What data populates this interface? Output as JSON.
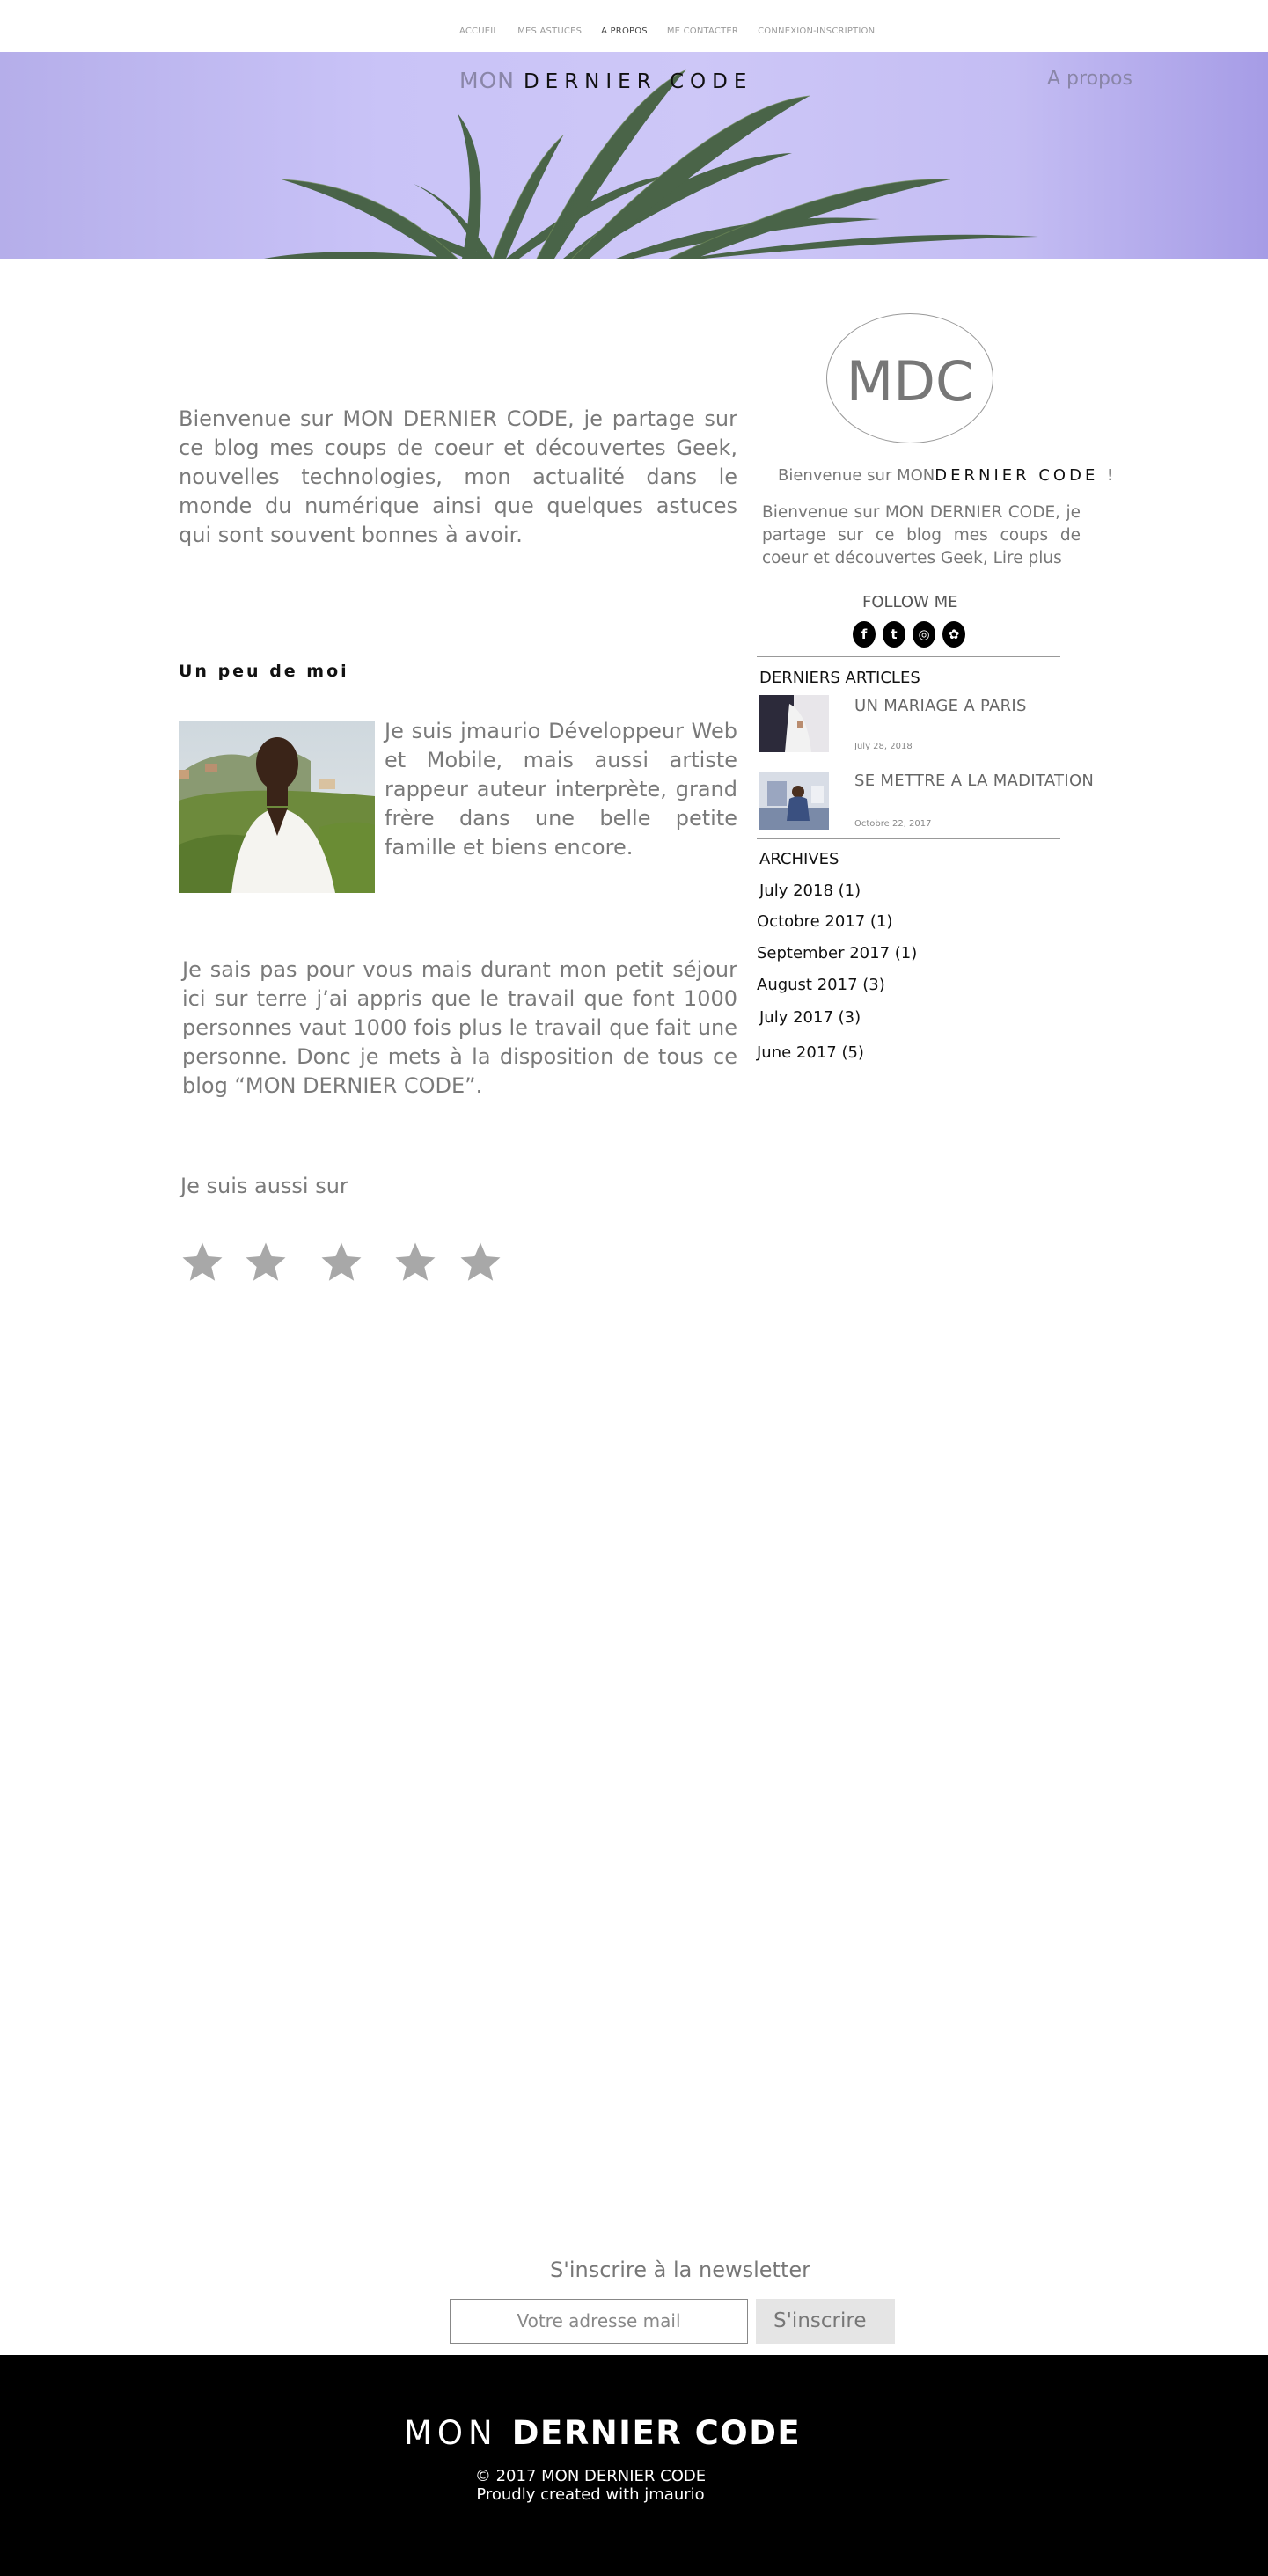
{
  "nav": {
    "items": [
      "ACCUEIL",
      "MES ASTUCES",
      "A PROPOS",
      "ME CONTACTER",
      "CONNEXION-INSCRIPTION"
    ],
    "active": "A PROPOS"
  },
  "header": {
    "brand_light": "MON",
    "brand_strong": "DERNIER CODE",
    "page_link": "A propos"
  },
  "main": {
    "intro": "Bienvenue sur MON DERNIER CODE, je partage sur ce blog mes coups de coeur et découvertes Geek, nouvelles technologies, mon actualité dans le monde du numérique ainsi que quelques  astuces qui sont souvent bonnes à avoir.",
    "section_title": "Un peu de moi",
    "about_me": "Je suis jmaurio Développeur Web et Mobile, mais aussi artiste rappeur auteur interprète, grand frère dans une belle petite famille et biens encore.",
    "sejour": "Je sais pas pour vous mais durant mon petit séjour ici sur terre j’ai appris que le travail que font 1000 personnes  vaut 1000 fois plus le travail que fait une personne. Donc je mets à la disposition de tous ce blog “MON DERNIER CODE”.",
    "also_on": "Je suis aussi sur",
    "star_rating": 5
  },
  "sidebar": {
    "logo": "MDC",
    "welcome_light": "Bienvenue sur MON",
    "welcome_strong": "DERNIER CODE !",
    "description": "Bienvenue sur MON DERNIER CODE, je partage sur ce blog mes coups de coeur et découvertes Geek,  Lire plus",
    "follow_me": "FOLLOW ME",
    "socials": [
      {
        "name": "facebook-icon",
        "glyph": "f"
      },
      {
        "name": "twitter-icon",
        "glyph": "t"
      },
      {
        "name": "instagram-icon",
        "glyph": "◎"
      },
      {
        "name": "snapchat-icon",
        "glyph": "✿"
      }
    ],
    "latest_heading": "DERNIERS ARTICLES",
    "articles": [
      {
        "title": "UN MARIAGE A PARIS",
        "date": "July 28, 2018"
      },
      {
        "title": "SE METTRE A LA MADITATION",
        "date": "Octobre 22, 2017"
      }
    ],
    "archives_heading": "ARCHIVES",
    "archives": [
      "July 2018 (1)",
      "Octobre 2017 (1)",
      "September 2017 (1)",
      "August 2017 (3)",
      "July 2017 (3)",
      "June 2017 (5)"
    ]
  },
  "newsletter": {
    "title": "S'inscrire à la newsletter",
    "placeholder": "Votre adresse mail",
    "button": "S'inscrire"
  },
  "footer": {
    "brand_light": "MON",
    "brand_strong": "DERNIER CODE",
    "copyright": "© 2017 MON DERNIER CODE",
    "credit": "Proudly created with jmaurio"
  },
  "colors": {
    "hero": "#c9c3f7",
    "footer": "#000000",
    "text_grey": "#7a7a7a"
  }
}
